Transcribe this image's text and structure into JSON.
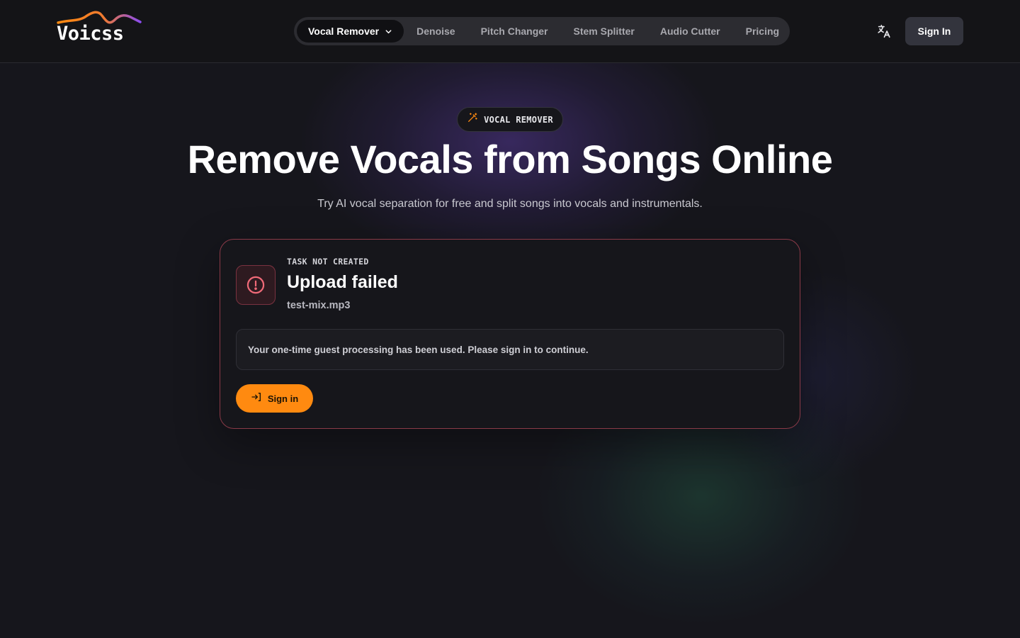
{
  "header": {
    "logo_text": "Voicss",
    "nav": [
      {
        "label": "Vocal Remover",
        "active": true,
        "has_dropdown": true
      },
      {
        "label": "Denoise"
      },
      {
        "label": "Pitch Changer"
      },
      {
        "label": "Stem Splitter"
      },
      {
        "label": "Audio Cutter"
      },
      {
        "label": "Pricing"
      }
    ],
    "language_icon": "translate-icon",
    "sign_in_label": "Sign In"
  },
  "hero": {
    "badge_icon": "magic-wand-icon",
    "badge_label": "VOCAL REMOVER",
    "title": "Remove Vocals from Songs Online",
    "subtitle": "Try AI vocal separation for free and split songs into vocals and instrumentals."
  },
  "error_card": {
    "icon": "alert-circle-icon",
    "eyebrow": "TASK NOT CREATED",
    "title": "Upload failed",
    "file_name": "test-mix.mp3",
    "message": "Your one-time guest processing has been used. Please sign in to continue.",
    "button_icon": "sign-in-icon",
    "button_label": "Sign in"
  },
  "colors": {
    "accent": "#ff8a10",
    "error_border": "#8a3a48",
    "background": "#16161c"
  }
}
